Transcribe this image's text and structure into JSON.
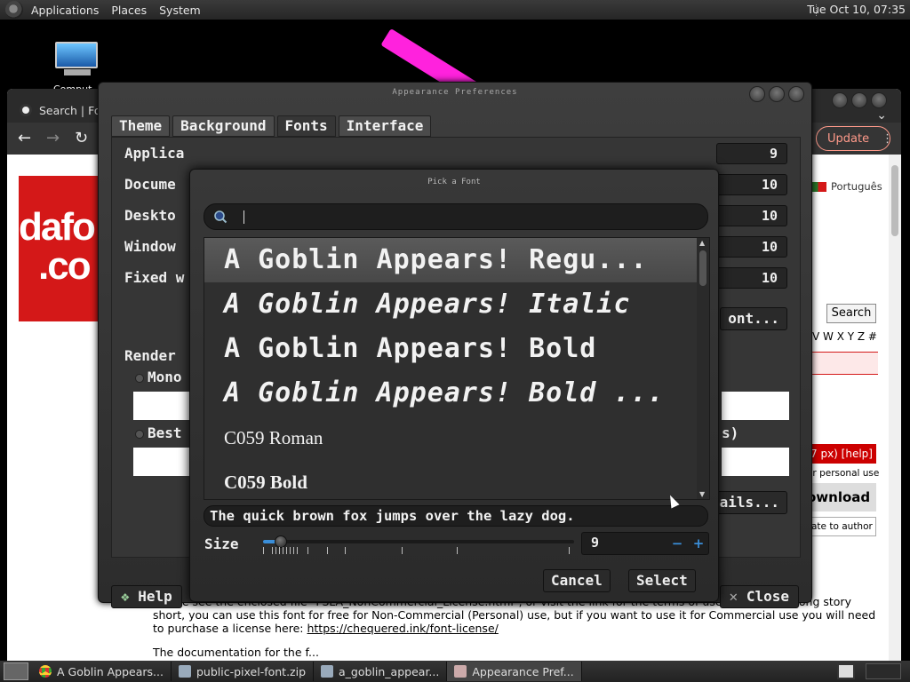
{
  "top_panel": {
    "menus": [
      "Applications",
      "Places",
      "System"
    ],
    "clock": "Tue Oct 10, 07:35"
  },
  "desktop": {
    "icon_label": "Comput"
  },
  "browser": {
    "tab_title": "Search | Fo",
    "update_label": "Update",
    "language": "Português",
    "search_button": "Search",
    "alphabet": "V W X Y Z #",
    "size_note": "7 px) [help]",
    "personal_use": "or personal use",
    "download_label": "ownload",
    "donate_label": "ate to author",
    "logo_line1": "dafo",
    "logo_line2": ".co",
    "license_text": "Please see the enclosed file \"FSLA_NonCommercial_License.html\", or visit the link for the terms of use of this font. Long story short, you can use this font for free for Non-Commercial (Personal) use, but if you want to use it for Commercial use you will need to purchase a license here: ",
    "license_link": "https://chequered.ink/font-license/",
    "license_cut": "The documentation for the f..."
  },
  "prefs": {
    "title": "Appearance Preferences",
    "tabs": [
      "Theme",
      "Background",
      "Fonts",
      "Interface"
    ],
    "active_tab": "Fonts",
    "rows": [
      {
        "label": "Applica",
        "value": "9"
      },
      {
        "label": "Docume",
        "value": "10"
      },
      {
        "label": "Deskto",
        "value": "10"
      },
      {
        "label": "Window",
        "value": "10"
      },
      {
        "label": "Fixed w",
        "value": "10"
      }
    ],
    "font_button": "ont...",
    "rendering_label": "Render",
    "mono_label": "Mono",
    "best_label": "Best",
    "best_suffix": "s)",
    "details_button": "tails...",
    "help_button": "Help",
    "close_button": "Close"
  },
  "picker": {
    "title": "Pick a Font",
    "search_value": "",
    "fonts": [
      {
        "name": "A Goblin Appears! Regu...",
        "style": "pixel",
        "selected": true
      },
      {
        "name": "A Goblin Appears! Italic",
        "style": "pixel italic",
        "selected": false
      },
      {
        "name": "A Goblin Appears! Bold",
        "style": "pixel",
        "selected": false
      },
      {
        "name": "A Goblin Appears! Bold ...",
        "style": "pixel italic",
        "selected": false
      },
      {
        "name": "C059 Roman",
        "style": "serif",
        "selected": false
      },
      {
        "name": "C059 Bold",
        "style": "serif bold",
        "selected": false
      }
    ],
    "sample_text": "The quick brown fox jumps over the lazy dog.",
    "size_label": "Size",
    "size_value": "9",
    "size_slider_fraction": 0.02,
    "minus": "−",
    "plus": "+",
    "cancel_button": "Cancel",
    "select_button": "Select"
  },
  "taskbar": {
    "tasks": [
      {
        "label": "A Goblin Appears...",
        "icon": "chrome-icon"
      },
      {
        "label": "public-pixel-font.zip",
        "icon": "archive-icon"
      },
      {
        "label": "a_goblin_appear...",
        "icon": "archive-icon"
      },
      {
        "label": "Appearance Pref...",
        "icon": "appearance-icon"
      }
    ]
  },
  "colors": {
    "accent": "#3a8ed9",
    "dafont_red": "#d41818",
    "desktop_streak": "#ff22dd"
  }
}
